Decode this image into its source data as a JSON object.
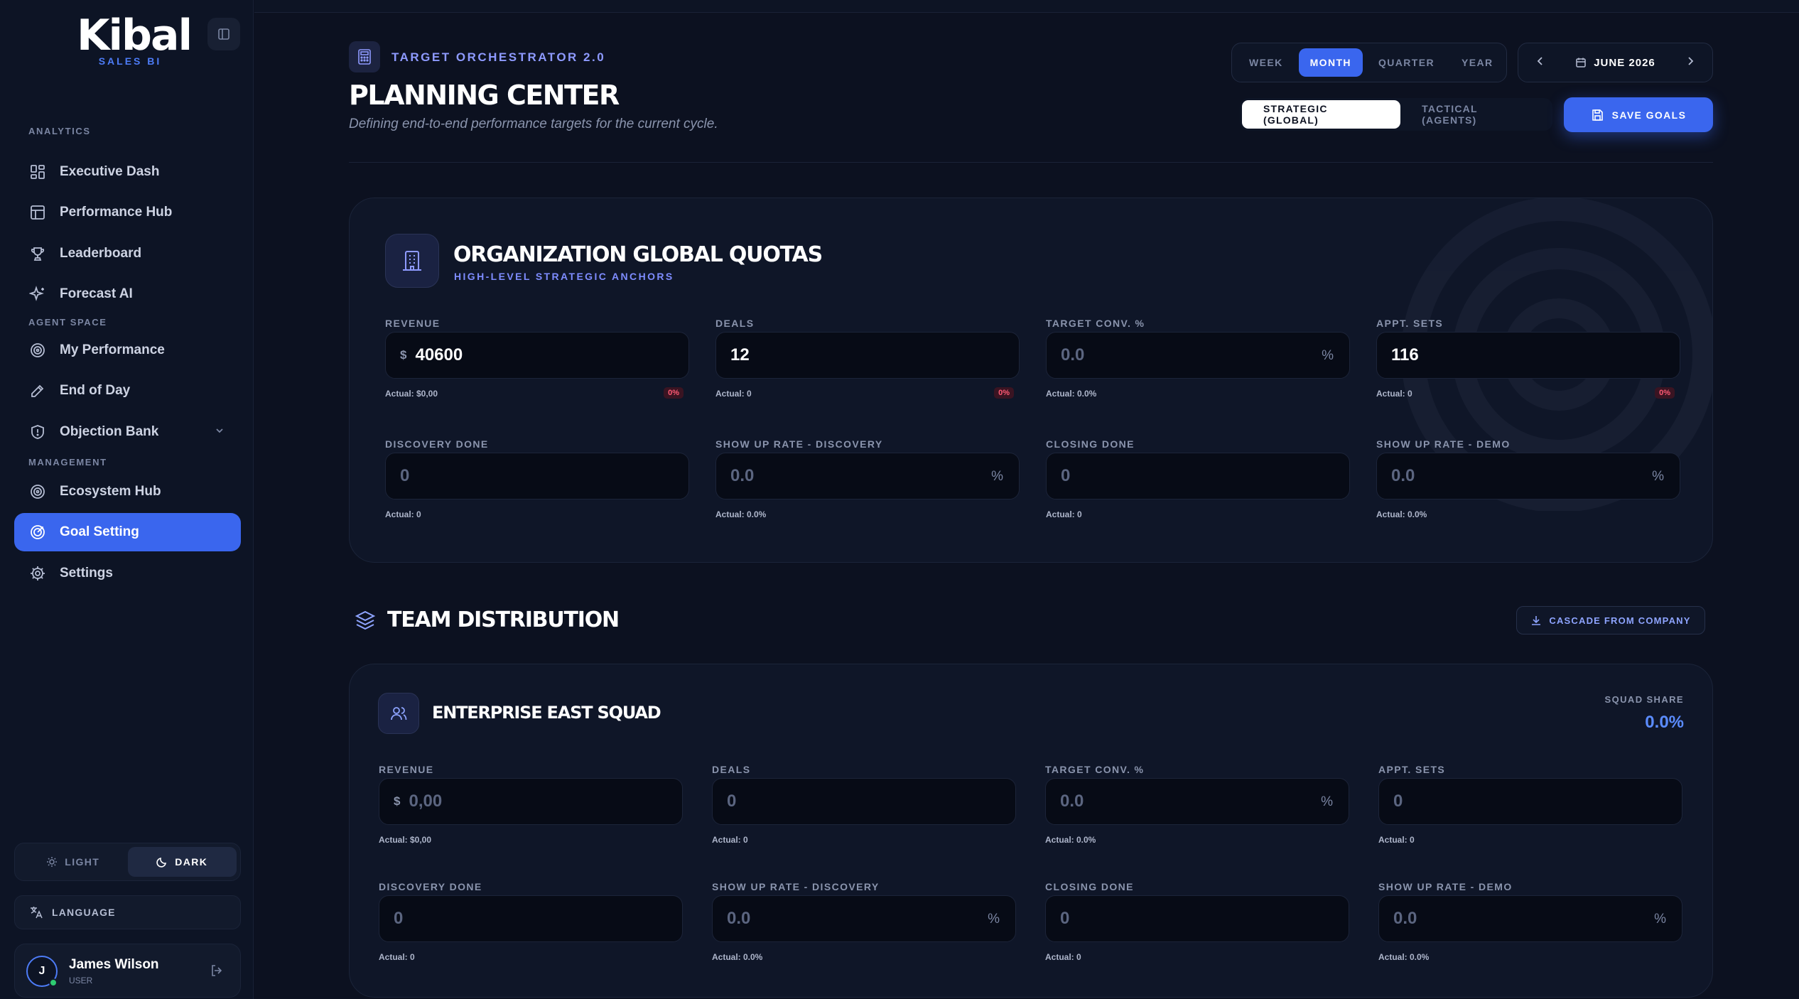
{
  "brand": {
    "name": "Kibal",
    "tagline": "SALES BI"
  },
  "sidebar": {
    "sections": {
      "analytics": "ANALYTICS",
      "agent_space": "AGENT SPACE",
      "management": "MANAGEMENT"
    },
    "items": [
      {
        "label": "Executive Dash",
        "icon": "dashboard-grid-icon"
      },
      {
        "label": "Performance Hub",
        "icon": "table-icon"
      },
      {
        "label": "Leaderboard",
        "icon": "trophy-icon"
      },
      {
        "label": "Forecast AI",
        "icon": "sparkles-icon"
      },
      {
        "label": "My Performance",
        "icon": "target-icon"
      },
      {
        "label": "End of Day",
        "icon": "pen-icon"
      },
      {
        "label": "Objection Bank",
        "icon": "shield-icon"
      },
      {
        "label": "Ecosystem Hub",
        "icon": "target-icon"
      },
      {
        "label": "Goal Setting",
        "icon": "goal-icon",
        "active": true
      },
      {
        "label": "Settings",
        "icon": "gear-icon"
      }
    ],
    "theme": {
      "light": "LIGHT",
      "dark": "DARK",
      "selected": "dark"
    },
    "language": "LANGUAGE",
    "user": {
      "initial": "J",
      "name": "James Wilson",
      "role": "USER"
    }
  },
  "header": {
    "kicker": "TARGET ORCHESTRATOR 2.0",
    "title": "PLANNING CENTER",
    "subtitle": "Defining end-to-end performance targets for the current cycle.",
    "periods": [
      "WEEK",
      "MONTH",
      "QUARTER",
      "YEAR"
    ],
    "selected_period": "MONTH",
    "date_label": "JUNE 2026",
    "modes": [
      "STRATEGIC (GLOBAL)",
      "TACTICAL (AGENTS)"
    ],
    "selected_mode": "STRATEGIC (GLOBAL)",
    "save_label": "SAVE GOALS"
  },
  "global": {
    "title": "ORGANIZATION GLOBAL QUOTAS",
    "kicker": "HIGH-LEVEL STRATEGIC ANCHORS",
    "metrics": [
      {
        "label": "REVENUE",
        "currency": "$",
        "value": "40600",
        "actual": "Actual: $0,00",
        "badge": "0%"
      },
      {
        "label": "DEALS",
        "value": "12",
        "actual": "Actual: 0",
        "badge": "0%"
      },
      {
        "label": "TARGET CONV. %",
        "value": "0.0",
        "unit": "%",
        "actual": "Actual: 0.0%"
      },
      {
        "label": "APPT. SETS",
        "value": "116",
        "actual": "Actual: 0",
        "badge": "0%"
      },
      {
        "label": "DISCOVERY DONE",
        "value": "0",
        "actual": "Actual: 0"
      },
      {
        "label": "SHOW UP RATE - DISCOVERY",
        "value": "0.0",
        "unit": "%",
        "actual": "Actual: 0.0%"
      },
      {
        "label": "CLOSING DONE",
        "value": "0",
        "actual": "Actual: 0"
      },
      {
        "label": "SHOW UP RATE - DEMO",
        "value": "0.0",
        "unit": "%",
        "actual": "Actual: 0.0%"
      }
    ]
  },
  "team": {
    "section_title": "TEAM DISTRIBUTION",
    "cascade_label": "CASCADE FROM COMPANY",
    "squad": {
      "name": "ENTERPRISE EAST SQUAD",
      "share_label": "SQUAD SHARE",
      "share_value": "0.0%",
      "metrics": [
        {
          "label": "REVENUE",
          "currency": "$",
          "value": "0,00",
          "actual": "Actual: $0,00"
        },
        {
          "label": "DEALS",
          "value": "0",
          "actual": "Actual: 0"
        },
        {
          "label": "TARGET CONV. %",
          "value": "0.0",
          "unit": "%",
          "actual": "Actual: 0.0%"
        },
        {
          "label": "APPT. SETS",
          "value": "0",
          "actual": "Actual: 0"
        },
        {
          "label": "DISCOVERY DONE",
          "value": "0",
          "actual": "Actual: 0"
        },
        {
          "label": "SHOW UP RATE - DISCOVERY",
          "value": "0.0",
          "unit": "%",
          "actual": "Actual: 0.0%"
        },
        {
          "label": "CLOSING DONE",
          "value": "0",
          "actual": "Actual: 0"
        },
        {
          "label": "SHOW UP RATE - DEMO",
          "value": "0.0",
          "unit": "%",
          "actual": "Actual: 0.0%"
        }
      ]
    }
  },
  "colors": {
    "accent": "#3a66ee",
    "background": "#0c1120",
    "danger": "#ff5a74",
    "success": "#2ecc71"
  }
}
